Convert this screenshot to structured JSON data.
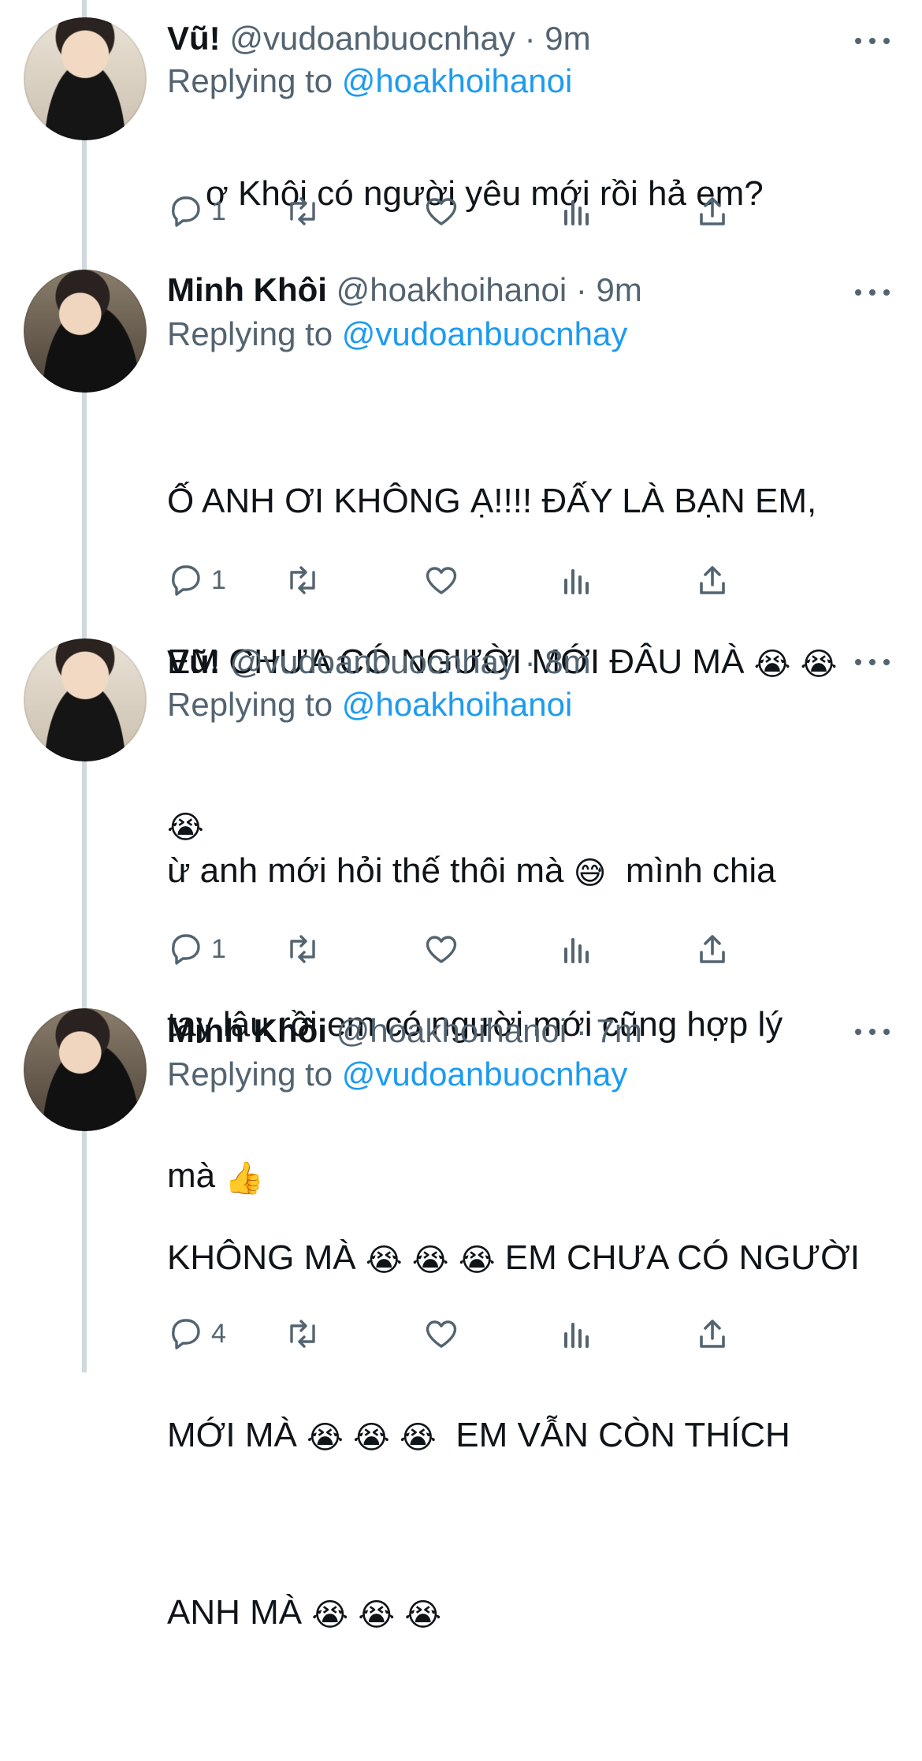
{
  "tweets": [
    {
      "name": "Vũ!",
      "handle": "@vudoanbuocnhay",
      "dot": "·",
      "time": "9m",
      "replying_label": "Replying to",
      "replying_to": "@hoakhoihanoi",
      "text": "ơ Khôi có người yêu mới rồi hả em?",
      "reply_count": "1"
    },
    {
      "name": "Minh Khôi",
      "handle": "@hoakhoihanoi",
      "dot": "·",
      "time": "9m",
      "replying_label": "Replying to",
      "replying_to": "@vudoanbuocnhay",
      "text_line1": "Ố ANH ƠI KHÔNG Ạ!!!! ĐẤY LÀ BẠN EM,",
      "text_line2": "EM CHƯA CÓ NGƯỜI MỚI ĐÂU MÀ",
      "emoji": "😭",
      "reply_count": "1"
    },
    {
      "name": "Vũ!",
      "handle": "@vudoanbuocnhay",
      "dot": "·",
      "time": "8m",
      "replying_label": "Replying to",
      "replying_to": "@hoakhoihanoi",
      "text_part1": "ừ anh mới hỏi thế thôi mà",
      "emoji_sweat": "😅",
      "text_part2": "mình chia",
      "text_line2": "tay lâu rồi em có người mới cũng hợp lý",
      "text_line3": "mà",
      "emoji_thumb": "👍",
      "reply_count": "1"
    },
    {
      "name": "Minh Khôi",
      "handle": "@hoakhoihanoi",
      "dot": "·",
      "time": "7m",
      "replying_label": "Replying to",
      "replying_to": "@vudoanbuocnhay",
      "text_line1a": "KHÔNG MÀ",
      "text_line1b": "EM CHƯA CÓ NGƯỜI",
      "text_line2a": "MỚI MÀ",
      "text_line2b": "EM VẪN CÒN THÍCH",
      "text_line3a": "ANH MÀ",
      "emoji": "😭",
      "reply_count": "4"
    }
  ],
  "icons": {
    "reply": "reply-icon",
    "retweet": "retweet-icon",
    "like": "heart-icon",
    "views": "analytics-icon",
    "share": "share-icon",
    "more": "more-icon"
  },
  "colors": {
    "text": "#0f1419",
    "secondary": "#536471",
    "link": "#1d9bf0",
    "thread_line": "#cfd9de"
  }
}
